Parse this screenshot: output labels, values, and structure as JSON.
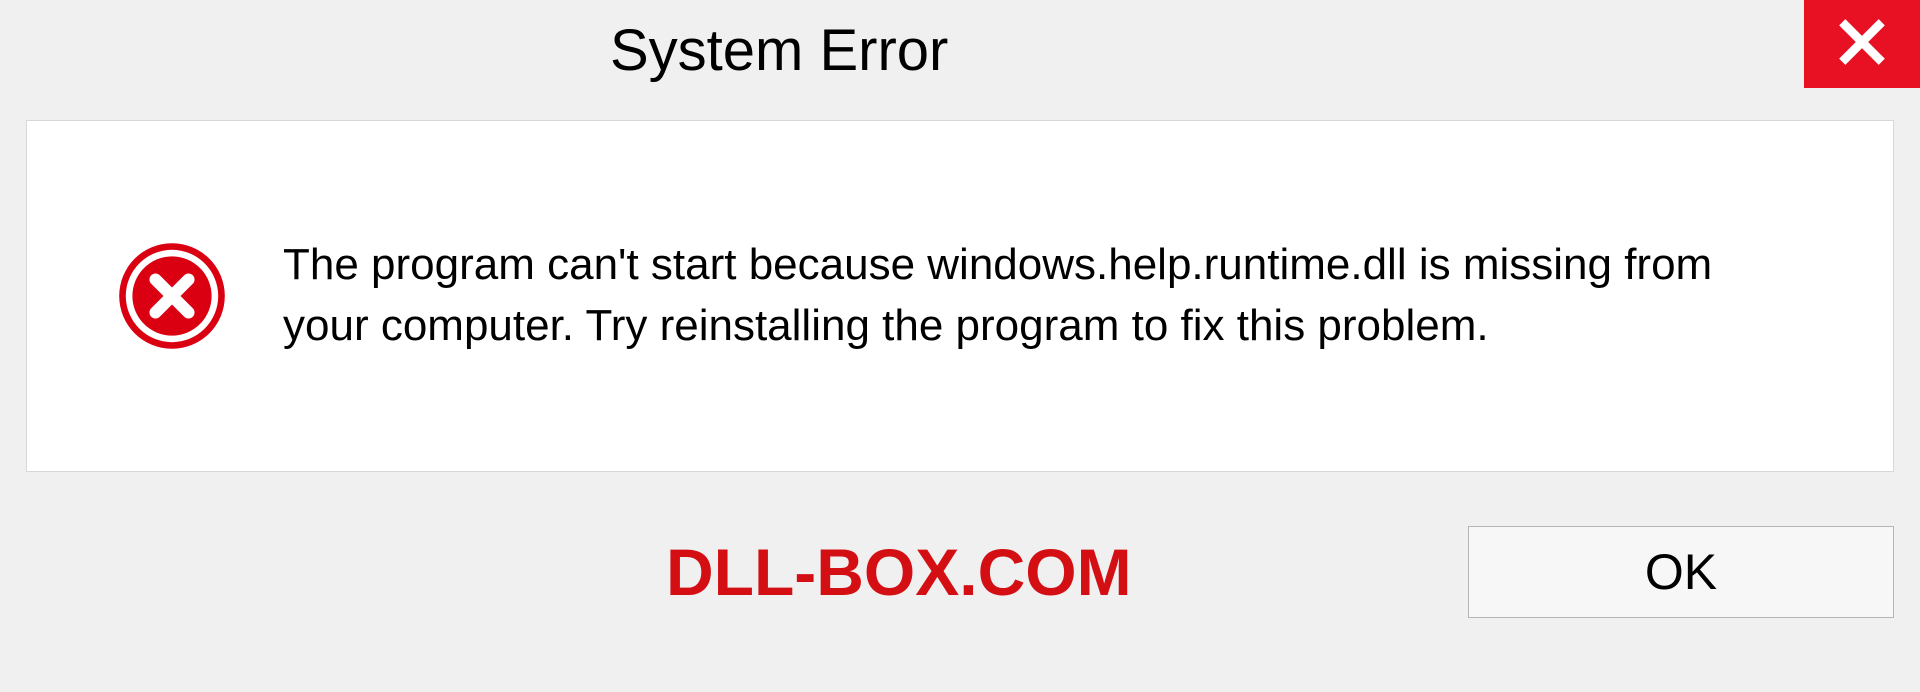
{
  "title": "System Error",
  "message": "The program can't start because windows.help.runtime.dll is missing from your computer. Try reinstalling the program to fix this problem.",
  "branding": "DLL-BOX.COM",
  "buttons": {
    "ok": "OK"
  },
  "colors": {
    "close_bg": "#e81123",
    "error_icon": "#da0012",
    "branding": "#d40f14"
  }
}
